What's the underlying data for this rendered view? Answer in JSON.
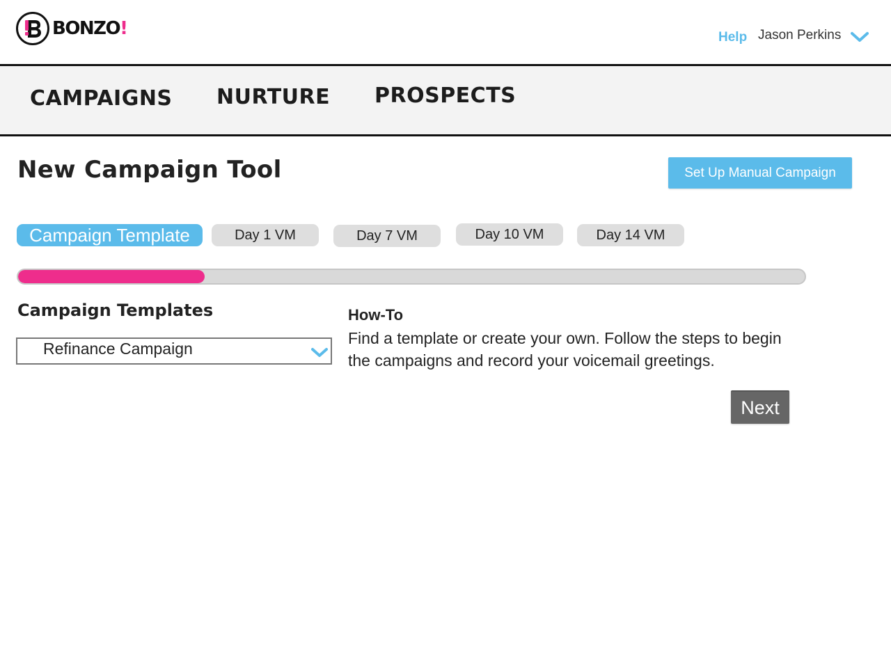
{
  "header": {
    "logo_text": "BONZO",
    "logo_bang": "!",
    "help_label": "Help",
    "user_name": "Jason Perkins"
  },
  "nav": {
    "items": [
      {
        "label": "CAMPAIGNS"
      },
      {
        "label": "NURTURE"
      },
      {
        "label": "PROSPECTS"
      }
    ]
  },
  "page": {
    "title": "New Campaign Tool",
    "manual_button_label": "Set Up Manual Campaign"
  },
  "steps": {
    "tabs": [
      {
        "label": "Campaign Template",
        "active": true
      },
      {
        "label": "Day 1 VM",
        "active": false
      },
      {
        "label": "Day 7 VM",
        "active": false
      },
      {
        "label": "Day 10 VM",
        "active": false
      },
      {
        "label": "Day 14 VM",
        "active": false
      }
    ],
    "progress_fraction": 0.237
  },
  "templates": {
    "heading": "Campaign Templates",
    "selected_value": "Refinance Campaign"
  },
  "howto": {
    "heading": "How-To",
    "text": "Find a template or create your own. Follow the steps to begin the campaigns and record your voicemail greetings."
  },
  "actions": {
    "next_label": "Next"
  },
  "colors": {
    "accent_blue": "#5bbbea",
    "brand_pink": "#ee2d8c",
    "next_gray": "#666666"
  },
  "icons": {
    "logo": "bonzo-logo-icon",
    "user_menu": "chevron-down-icon",
    "select": "chevron-down-icon"
  }
}
